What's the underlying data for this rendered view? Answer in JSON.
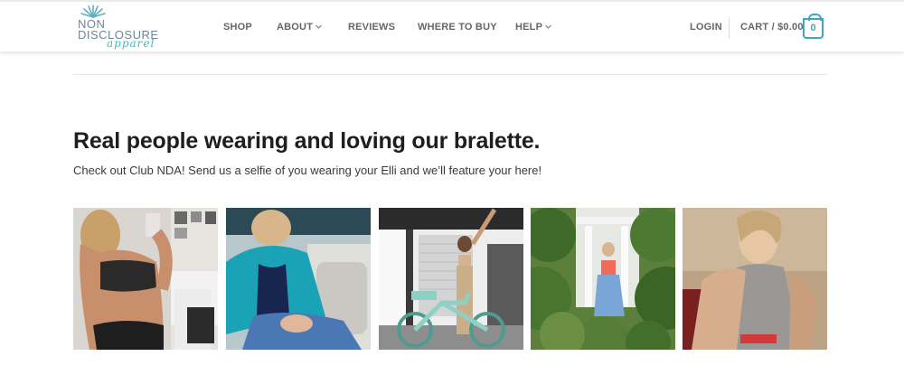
{
  "brand": {
    "line1": "NON",
    "line2": "DISCLOSURE",
    "line3": "apparel"
  },
  "nav": {
    "shop": "SHOP",
    "about": "ABOUT",
    "reviews": "REVIEWS",
    "where_to_buy": "WHERE TO BUY",
    "help": "HELP"
  },
  "account": {
    "login": "LOGIN",
    "cart": "CART / $0.00",
    "cart_count": "0"
  },
  "section": {
    "title": "Real people wearing and loving our bralette.",
    "subtitle": "Check out Club NDA! Send us a selfie of you wearing your Elli and we’ll feature your here!"
  },
  "colors": {
    "accent": "#44a5b8",
    "logo_script": "#44bcc4",
    "nav_text": "#666666",
    "title_text": "#1e1e1e"
  },
  "icons": {
    "chevron": "chevron-down-icon",
    "cart": "shopping-bag-icon",
    "logo_mark": "agave-plant-icon"
  }
}
